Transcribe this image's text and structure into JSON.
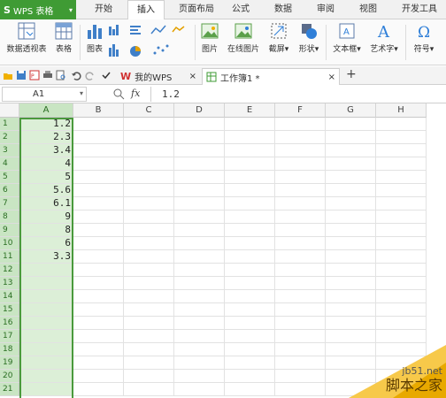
{
  "app": {
    "name": "WPS 表格"
  },
  "menu": {
    "tabs": [
      "开始",
      "插入",
      "页面布局",
      "公式",
      "数据",
      "审阅",
      "视图",
      "开发工具"
    ],
    "active": "插入"
  },
  "ribbon": {
    "pivot": "数据透视表",
    "table": "表格",
    "chart": "图表",
    "picture": "图片",
    "online_picture": "在线图片",
    "screenshot": "截屏",
    "shapes": "形状",
    "textbox": "文本框",
    "wordart": "艺术字",
    "symbol": "符号",
    "screenshot_arrow": "▾",
    "shapes_arrow": "▾",
    "textbox_arrow": "▾",
    "wordart_arrow": "▾",
    "symbol_arrow": "▾"
  },
  "tabs": {
    "wps": "我的WPS",
    "doc": "工作簿1 *",
    "close1": "×",
    "close2": "×",
    "add": "+"
  },
  "formula_bar": {
    "cell_ref": "A1",
    "fx": "fx",
    "value": "1.2"
  },
  "grid": {
    "columns": [
      "A",
      "B",
      "C",
      "D",
      "E",
      "F",
      "G",
      "H"
    ],
    "rows": [
      "1",
      "2",
      "3",
      "4",
      "5",
      "6",
      "7",
      "8",
      "9",
      "10",
      "11",
      "12",
      "13",
      "14",
      "15",
      "16",
      "17",
      "18",
      "19",
      "20",
      "21"
    ],
    "a_values": [
      "1.2",
      "2.3",
      "3.4",
      "4",
      "5",
      "5.6",
      "6.1",
      "9",
      "8",
      "6",
      "3.3"
    ]
  },
  "watermark": {
    "line1": "jb51.net",
    "line2": "脚本之家"
  },
  "colors": {
    "accent": "#3f9b34",
    "selection": "#dcefd7"
  }
}
